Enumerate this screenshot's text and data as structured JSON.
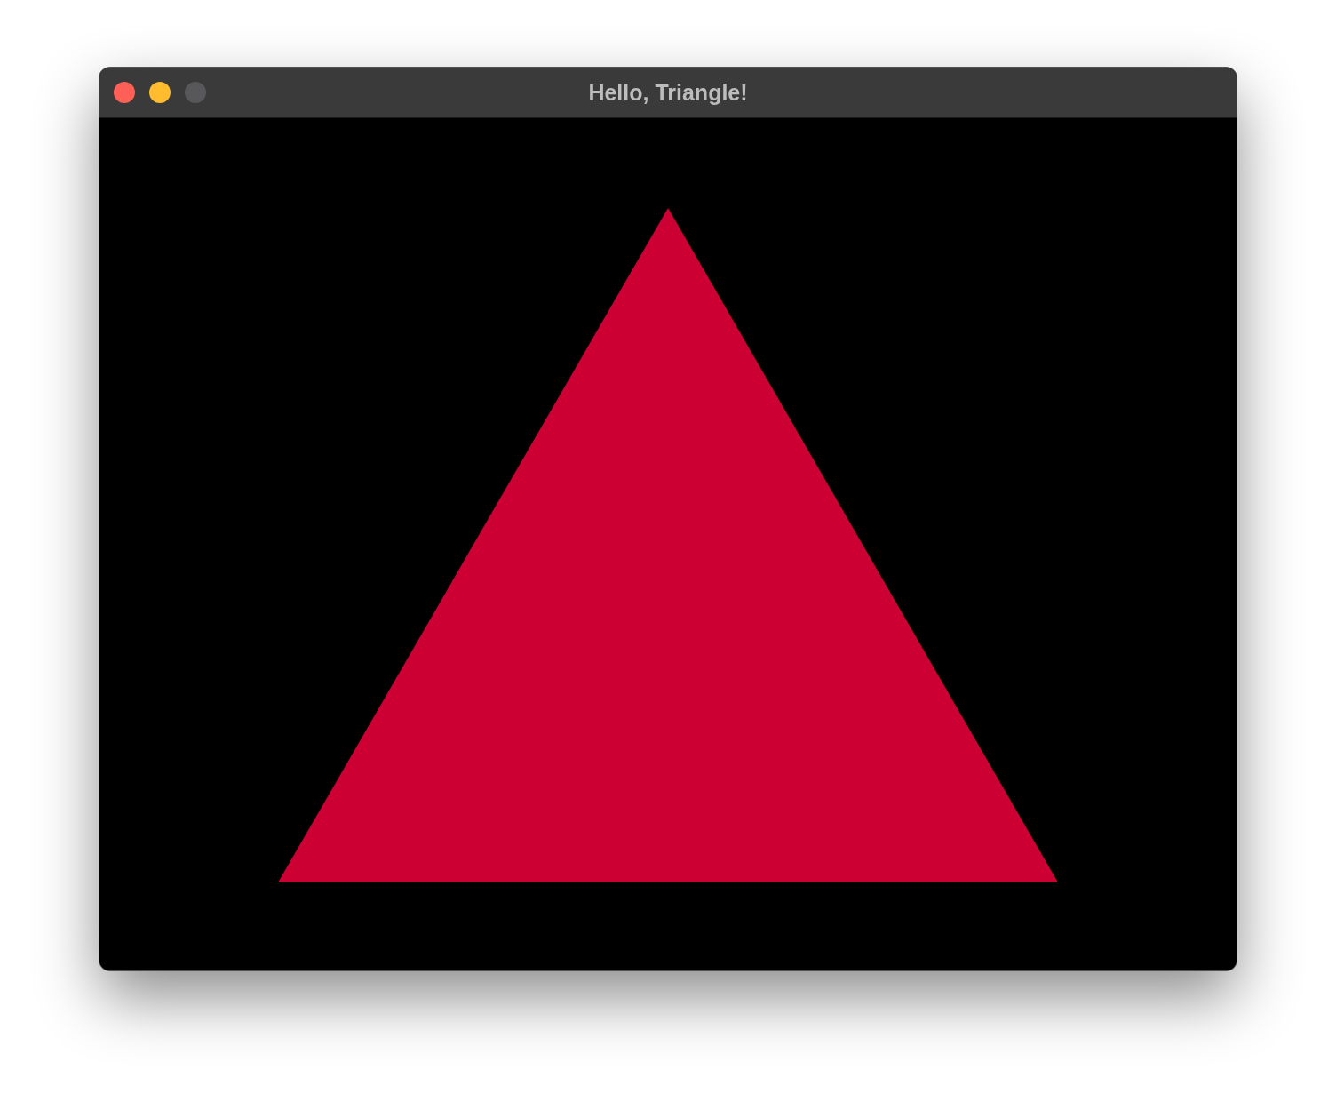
{
  "window": {
    "title": "Hello, Triangle!",
    "controls": [
      {
        "kind": "close",
        "disabled": false
      },
      {
        "kind": "minimize",
        "disabled": false
      },
      {
        "kind": "zoom",
        "disabled": true
      }
    ]
  }
}
